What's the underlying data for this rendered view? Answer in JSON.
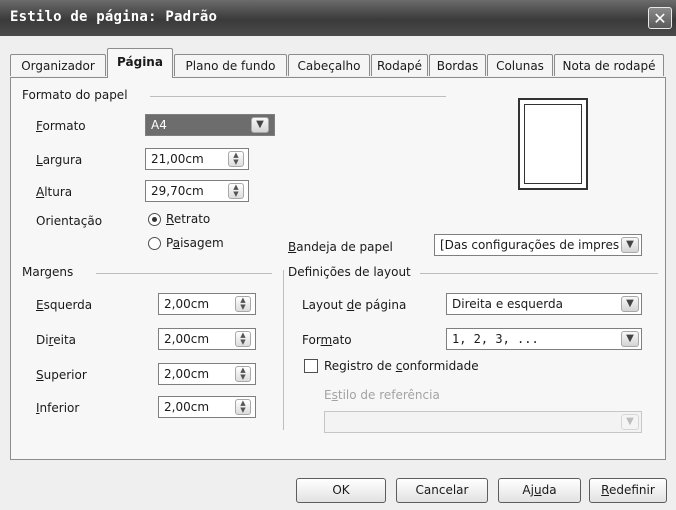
{
  "dialog": {
    "title": "Estilo de página: Padrão",
    "close": "✕"
  },
  "tabs": [
    {
      "label": "Organizador",
      "active": false
    },
    {
      "label": "Página",
      "active": true
    },
    {
      "label": "Plano de fundo",
      "active": false
    },
    {
      "label": "Cabeçalho",
      "active": false
    },
    {
      "label": "Rodapé",
      "active": false
    },
    {
      "label": "Bordas",
      "active": false
    },
    {
      "label": "Colunas",
      "active": false
    },
    {
      "label": "Nota de rodapé",
      "active": false
    }
  ],
  "paper_format": {
    "section": "Formato do papel",
    "format": {
      "pre": "",
      "key": "F",
      "post": "ormato",
      "value": "A4"
    },
    "width": {
      "pre": "",
      "key": "L",
      "post": "argura",
      "value": "21,00cm"
    },
    "height": {
      "pre": "",
      "key": "A",
      "post": "ltura",
      "value": "29,70cm"
    },
    "orientation": {
      "label": "Orientação",
      "portrait": {
        "pre": "",
        "key": "R",
        "post": "etrato",
        "selected": true
      },
      "landscape": {
        "pre": "P",
        "key": "a",
        "post": "isagem",
        "selected": false
      }
    },
    "tray": {
      "pre": "",
      "key": "B",
      "post": "andeja de papel",
      "value": "[Das configurações de impres"
    }
  },
  "margins": {
    "section": "Margens",
    "left": {
      "pre": "",
      "key": "E",
      "post": "squerda",
      "value": "2,00cm"
    },
    "right": {
      "pre": "Di",
      "key": "r",
      "post": "eita",
      "value": "2,00cm"
    },
    "top": {
      "pre": "",
      "key": "S",
      "post": "uperior",
      "value": "2,00cm"
    },
    "bottom": {
      "pre": "",
      "key": "I",
      "post": "nferior",
      "value": "2,00cm"
    }
  },
  "layout": {
    "section": "Definições de layout",
    "page_layout": {
      "pre": "Layout ",
      "key": "d",
      "post": "e página",
      "value": "Direita e esquerda"
    },
    "format": {
      "pre": "For",
      "key": "m",
      "post": "ato",
      "value": "1, 2, 3, ..."
    },
    "register": {
      "pre": "Registro de ",
      "key": "c",
      "post": "onformidade",
      "checked": false
    },
    "reference_style": {
      "pre": "E",
      "key": "s",
      "post": "tilo de referência",
      "value": ""
    }
  },
  "buttons": {
    "ok": {
      "pre": "",
      "key": "",
      "post": "OK"
    },
    "cancel": {
      "pre": "",
      "key": "",
      "post": "Cancelar"
    },
    "help": {
      "pre": "Aj",
      "key": "u",
      "post": "da"
    },
    "reset": {
      "pre": "",
      "key": "R",
      "post": "edefinir"
    }
  },
  "icons": {
    "close": "close-icon",
    "spin": "spin-updown-icon",
    "dropdown": "chevron-down-icon",
    "preview": "page-preview-icon"
  }
}
